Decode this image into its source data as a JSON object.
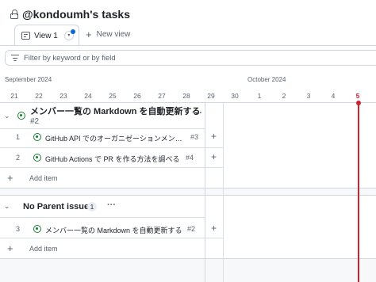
{
  "header": {
    "title": "@kondoumh's tasks"
  },
  "tabs": {
    "active_label": "View 1",
    "new_view_label": "New view"
  },
  "filter": {
    "placeholder": "Filter by keyword or by field"
  },
  "timeline": {
    "months": [
      "September 2024",
      "October 2024"
    ],
    "days": [
      "21",
      "22",
      "23",
      "24",
      "25",
      "26",
      "27",
      "28",
      "29",
      "30",
      "1",
      "2",
      "3",
      "4",
      "5"
    ],
    "today": "5"
  },
  "groups": [
    {
      "title": "メンバー一覧の Markdown を自動更新する",
      "number": "#2",
      "items": [
        {
          "row": "1",
          "title": "GitHub API でのオーガニゼーションメン…",
          "id": "#3"
        },
        {
          "row": "2",
          "title": "GitHub Actions で PR を作る方法を調べる",
          "id": "#4"
        }
      ],
      "add_label": "Add item"
    },
    {
      "title": "No Parent issue",
      "count": "1",
      "items": [
        {
          "row": "3",
          "title": "メンバー一覧の Markdown を自動更新する",
          "id": "#2"
        }
      ],
      "add_label": "Add item"
    }
  ],
  "colors": {
    "today": "#cf222e",
    "open_issue": "#1a7f37",
    "accent": "#0969da"
  }
}
